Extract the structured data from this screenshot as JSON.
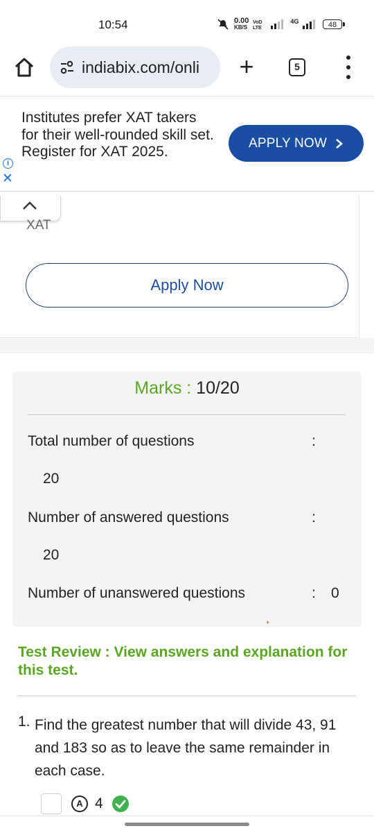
{
  "status_bar": {
    "time": "10:54",
    "data_rate": "0.00",
    "data_unit": "KB/S",
    "network": "4G",
    "battery": "48"
  },
  "browser": {
    "url": "indiabix.com/onli",
    "tab_count": "5",
    "plus": "+"
  },
  "ad": {
    "text": "Institutes prefer XAT takers for their well-rounded skill set. Register for XAT 2025.",
    "apply_label": "APPLY NOW",
    "apply_chevron": "›",
    "info_glyph": "i",
    "close_glyph": "✕",
    "secondary_label": "XAT",
    "apply_outline_label": "Apply Now"
  },
  "results": {
    "marks_label": "Marks :",
    "marks_value": "10/20",
    "rows": [
      {
        "label": "Total number of questions",
        "colon": ":",
        "value": "20"
      },
      {
        "label": "Number of answered questions",
        "colon": ":",
        "value": "20"
      },
      {
        "label": "Number of unanswered questions",
        "colon": ":",
        "value": "0"
      }
    ]
  },
  "review_link": "Test Review : View answers and explanation for this test.",
  "question": {
    "number": "1.",
    "text": "Find the greatest number that will divide 43, 91 and 183 so as to leave the same remainder in each case.",
    "option_letter": "A",
    "option_value": "4"
  },
  "colors": {
    "accent_green": "#5aa624",
    "apply_blue": "#1a4ea5",
    "correct_green": "#3fb14d"
  }
}
